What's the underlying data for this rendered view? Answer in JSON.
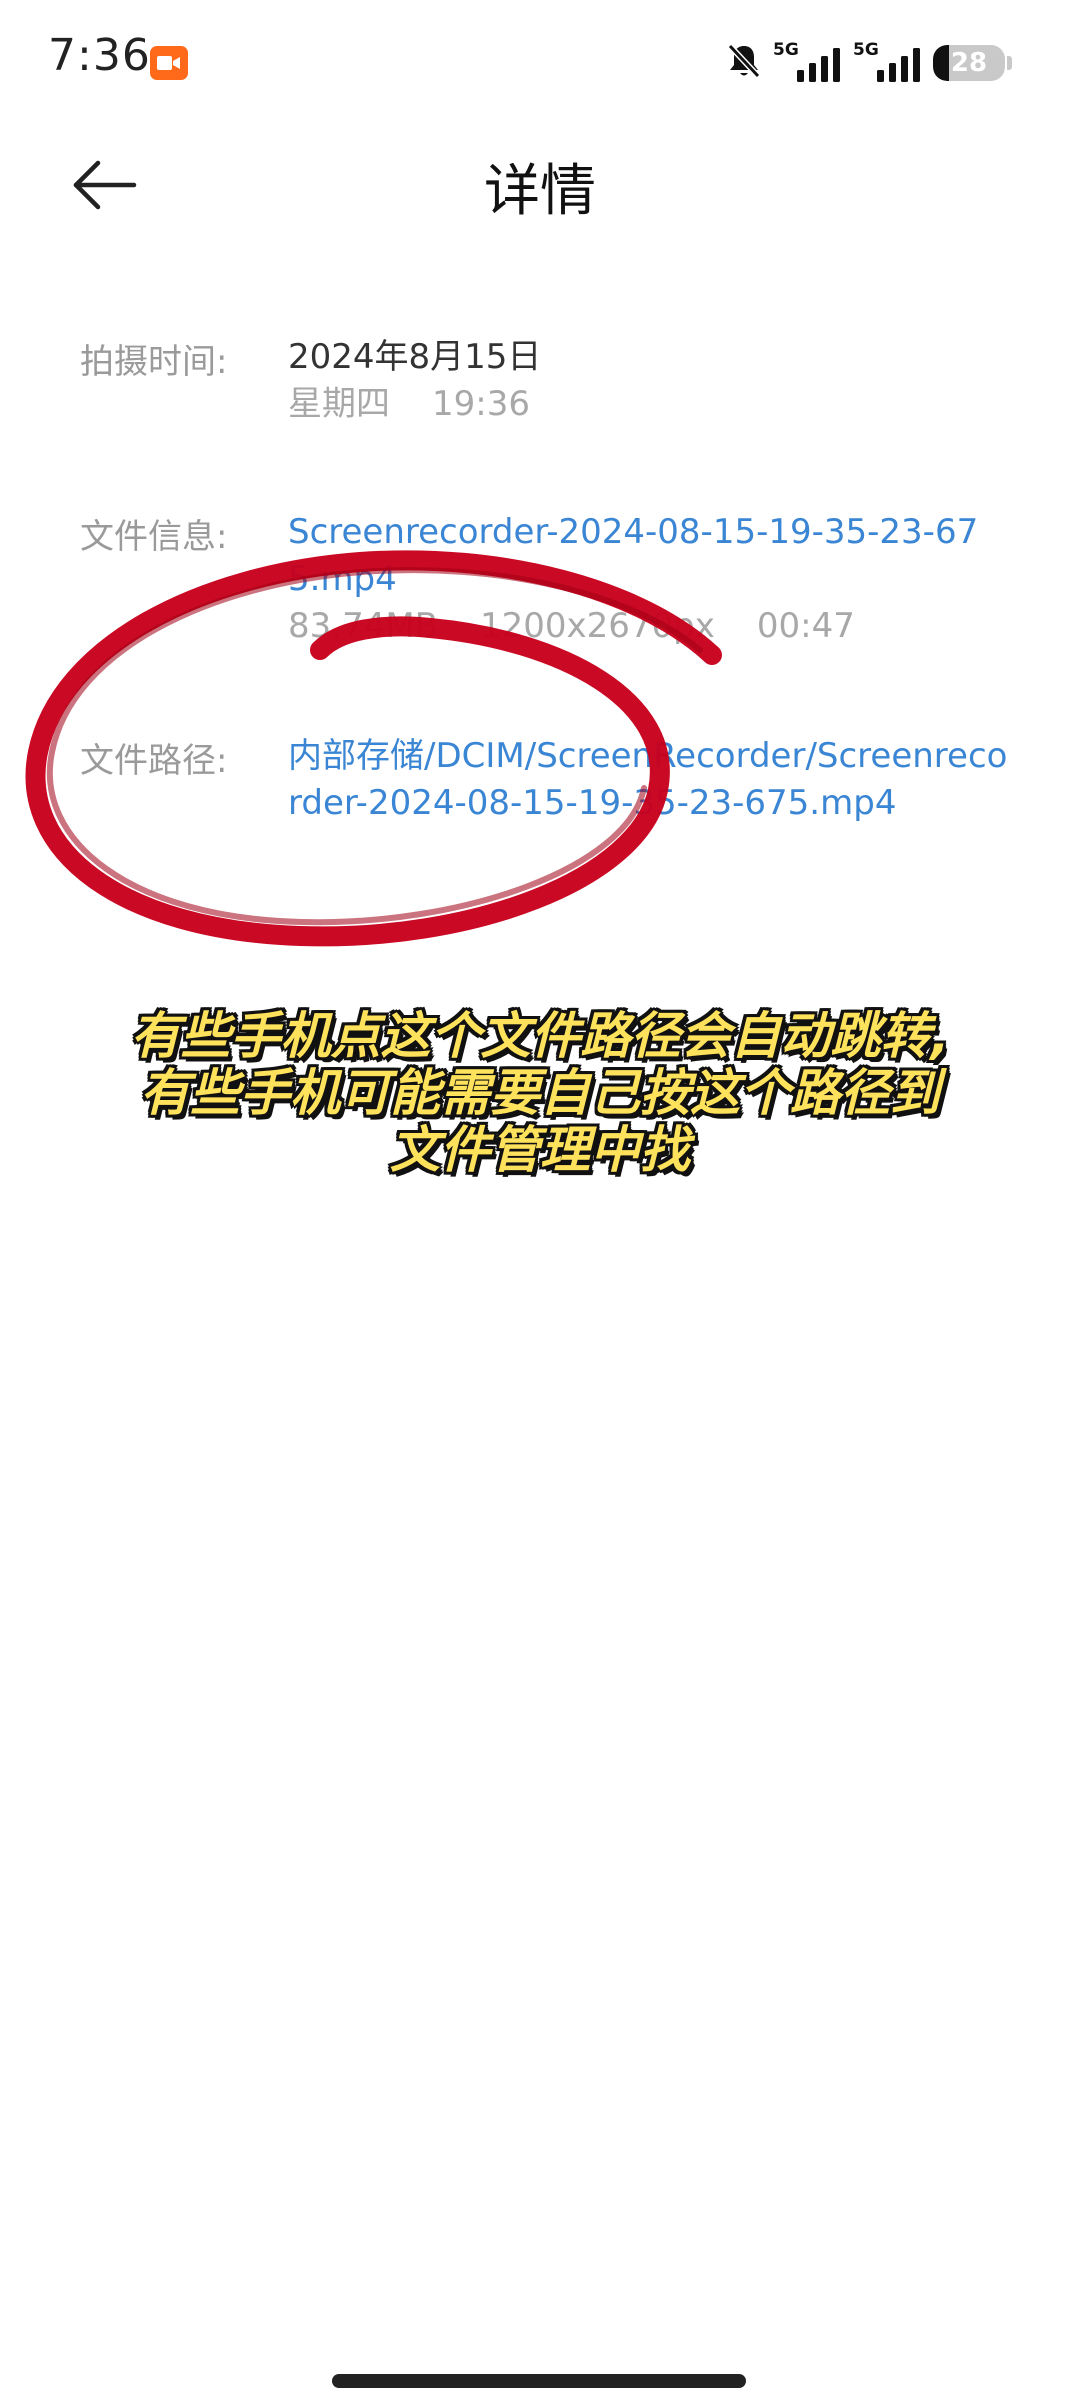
{
  "status_bar": {
    "time": "7:36",
    "signal_1_label": "5G",
    "signal_2_label": "5G",
    "battery_level": "28"
  },
  "header": {
    "title": "详情"
  },
  "details": {
    "capture_time": {
      "label": "拍摄时间:",
      "date": "2024年8月15日",
      "weekday": "星期四",
      "time": "19:36"
    },
    "file_info": {
      "label": "文件信息:",
      "file_name": "Screenrecorder-2024-08-15-19-35-23-675.mp4",
      "size": "83.74MB",
      "resolution": "1200x2670px",
      "duration": "00:47"
    },
    "file_path": {
      "label": "文件路径:",
      "path": "内部存储/DCIM/ScreenRecorder/Screenrecorder-2024-08-15-19-35-23-675.mp4"
    }
  },
  "caption": {
    "line1": "有些手机点这个文件路径会自动跳转,",
    "line2": "有些手机可能需要自己按这个路径到",
    "line3": "文件管理中找"
  },
  "colors": {
    "link": "#3a86d4",
    "annotation_red": "#c8001c",
    "caption_yellow": "#ffe25c",
    "recorder_badge": "#ff6a1a"
  },
  "icons": {
    "back": "arrow-left-icon",
    "recording": "video-camera-icon",
    "mute": "bell-off-icon",
    "signal": "signal-bars-icon",
    "battery": "battery-icon"
  }
}
